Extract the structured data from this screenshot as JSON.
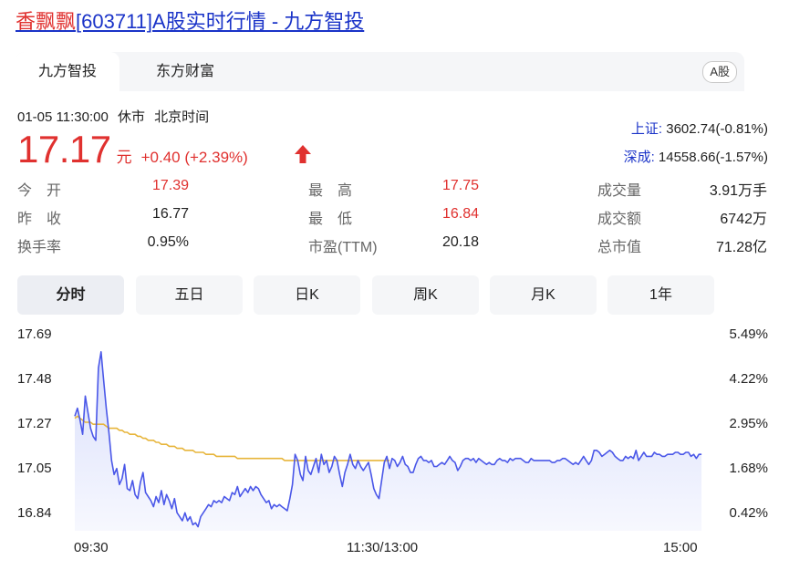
{
  "title": {
    "name": "香飘飘",
    "code": "[603711]",
    "rest": "A股实时行情 - 九方智投"
  },
  "source_tabs": [
    "九方智投",
    "东方财富"
  ],
  "market_badge": "A股",
  "status": {
    "datetime": "01-05 11:30:00",
    "state": "休市",
    "zone": "北京时间"
  },
  "quote": {
    "price": "17.17",
    "unit": "元",
    "change": "+0.40 (+2.39%)",
    "direction": "up",
    "color": "#e0312f"
  },
  "indices": [
    {
      "name": "上证:",
      "value": "3602.74(-0.81%)"
    },
    {
      "name": "深成:",
      "value": "14558.66(-1.57%)"
    }
  ],
  "stats": [
    {
      "label": "今　开",
      "value": "17.39",
      "highlight": true
    },
    {
      "label": "最　高",
      "value": "17.75",
      "highlight": true
    },
    {
      "label": "成交量",
      "value": "3.91万手",
      "highlight": false
    },
    {
      "label": "昨　收",
      "value": "16.77",
      "highlight": false
    },
    {
      "label": "最　低",
      "value": "16.84",
      "highlight": true
    },
    {
      "label": "成交额",
      "value": "6742万",
      "highlight": false
    },
    {
      "label": "换手率",
      "value": "0.95%",
      "highlight": false
    },
    {
      "label": "市盈(TTM)",
      "value": "20.18",
      "highlight": false
    },
    {
      "label": "总市值",
      "value": "71.28亿",
      "highlight": false
    }
  ],
  "period_tabs": [
    "分时",
    "五日",
    "日K",
    "周K",
    "月K",
    "1年"
  ],
  "chart_data": {
    "type": "line",
    "y_ticks": [
      "17.69",
      "17.48",
      "17.27",
      "17.05",
      "16.84"
    ],
    "y_pct_ticks": [
      "5.49%",
      "4.22%",
      "2.95%",
      "1.68%",
      "0.42%"
    ],
    "x_ticks": [
      "09:30",
      "11:30/13:00",
      "15:00"
    ],
    "ylim": [
      16.77,
      17.75
    ],
    "session_minutes": 240,
    "grid": false,
    "colors": {
      "price": "#4a57e8",
      "avg": "#e7b53b",
      "area": "#d6dcfb"
    },
    "series": [
      {
        "values": [
          17.34,
          17.38,
          17.32,
          17.25,
          17.44,
          17.36,
          17.28,
          17.24,
          17.22,
          17.58,
          17.66,
          17.52,
          17.38,
          17.26,
          17.12,
          17.05,
          17.08,
          17.0,
          17.03,
          17.1,
          16.98,
          16.97,
          17.02,
          16.95,
          16.93,
          17.01,
          17.06,
          16.96,
          16.94,
          16.92,
          16.89,
          16.94,
          16.91,
          16.97,
          16.9,
          16.95,
          16.92,
          16.88,
          16.93,
          16.86,
          16.84,
          16.82,
          16.86,
          16.82,
          16.84,
          16.8,
          16.81,
          16.79,
          16.84,
          16.86,
          16.88,
          16.9,
          16.89,
          16.92,
          16.91,
          16.92,
          16.91,
          16.94,
          16.93,
          16.92,
          16.96,
          16.95,
          16.99,
          16.94,
          16.96,
          16.98,
          16.96,
          16.99,
          16.97,
          16.99,
          16.98,
          16.95,
          16.93,
          16.91,
          16.92,
          16.88,
          16.9,
          16.89,
          16.9,
          16.89,
          16.88,
          16.87,
          16.93,
          17.0,
          17.15,
          17.12,
          17.05,
          17.02,
          17.14,
          17.07,
          17.05,
          17.09,
          17.13,
          17.06,
          17.15,
          17.1,
          17.12,
          17.06,
          17.09,
          17.14,
          17.12,
          17.05,
          16.99,
          17.06,
          17.1,
          17.15,
          17.1,
          17.08,
          17.12,
          17.09,
          17.07,
          17.09,
          17.11,
          17.05,
          16.98,
          16.95,
          16.93,
          17.02,
          17.11,
          17.14,
          17.08,
          17.13,
          17.12,
          17.09,
          17.11,
          17.14,
          17.1,
          17.09,
          17.06,
          17.06,
          17.1,
          17.13,
          17.14,
          17.12,
          17.12,
          17.11,
          17.12,
          17.09,
          17.09,
          17.1,
          17.11,
          17.1,
          17.12,
          17.14,
          17.12,
          17.11,
          17.07,
          17.09,
          17.12,
          17.13,
          17.13,
          17.12,
          17.13,
          17.11,
          17.13,
          17.12,
          17.11,
          17.1,
          17.11,
          17.1,
          17.1,
          17.12,
          17.13,
          17.12,
          17.12,
          17.11,
          17.13,
          17.12,
          17.13,
          17.13,
          17.13,
          17.12,
          17.11,
          17.11,
          17.13,
          17.12,
          17.12,
          17.12,
          17.12,
          17.12,
          17.12,
          17.12,
          17.11,
          17.11,
          17.12,
          17.12,
          17.13,
          17.13,
          17.12,
          17.11,
          17.1,
          17.11,
          17.1,
          17.12,
          17.14,
          17.12,
          17.1,
          17.12,
          17.17,
          17.17,
          17.16,
          17.14,
          17.15,
          17.16,
          17.17,
          17.16,
          17.14,
          17.13,
          17.12,
          17.12,
          17.14,
          17.13,
          17.14,
          17.13,
          17.17,
          17.12,
          17.14,
          17.16,
          17.14,
          17.14,
          17.14,
          17.16,
          17.15,
          17.15,
          17.14,
          17.14,
          17.15,
          17.15,
          17.15,
          17.16,
          17.16,
          17.15,
          17.15,
          17.16,
          17.16,
          17.14,
          17.15,
          17.13,
          17.15,
          17.15
        ]
      },
      {
        "values": [
          17.33,
          17.34,
          17.33,
          17.32,
          17.31,
          17.31,
          17.31,
          17.3,
          17.3,
          17.3,
          17.3,
          17.3,
          17.29,
          17.28,
          17.28,
          17.28,
          17.28,
          17.27,
          17.27,
          17.26,
          17.26,
          17.25,
          17.25,
          17.25,
          17.24,
          17.24,
          17.23,
          17.23,
          17.22,
          17.22,
          17.22,
          17.21,
          17.21,
          17.2,
          17.2,
          17.2,
          17.19,
          17.19,
          17.19,
          17.18,
          17.18,
          17.18,
          17.17,
          17.17,
          17.17,
          17.17,
          17.16,
          17.16,
          17.16,
          17.16,
          17.15,
          17.15,
          17.15,
          17.15,
          17.14,
          17.14,
          17.14,
          17.14,
          17.14,
          17.14,
          17.14,
          17.14,
          17.13,
          17.13,
          17.13,
          17.13,
          17.13,
          17.13,
          17.13,
          17.13,
          17.13,
          17.13,
          17.13,
          17.13,
          17.13,
          17.13,
          17.13,
          17.13,
          17.13,
          17.13,
          17.12,
          17.12,
          17.12,
          17.12,
          17.12,
          17.12,
          17.12,
          17.12,
          17.12,
          17.12,
          17.12,
          17.12,
          17.12,
          17.12,
          17.12,
          17.12,
          17.12,
          17.12,
          17.12,
          17.12,
          17.12,
          17.12,
          17.12,
          17.12,
          17.12,
          17.12,
          17.12,
          17.12,
          17.12,
          17.12,
          17.12,
          17.12,
          17.12,
          17.12,
          17.12,
          17.12,
          17.12,
          17.12,
          17.12,
          17.12,
          17.12
        ]
      }
    ]
  }
}
